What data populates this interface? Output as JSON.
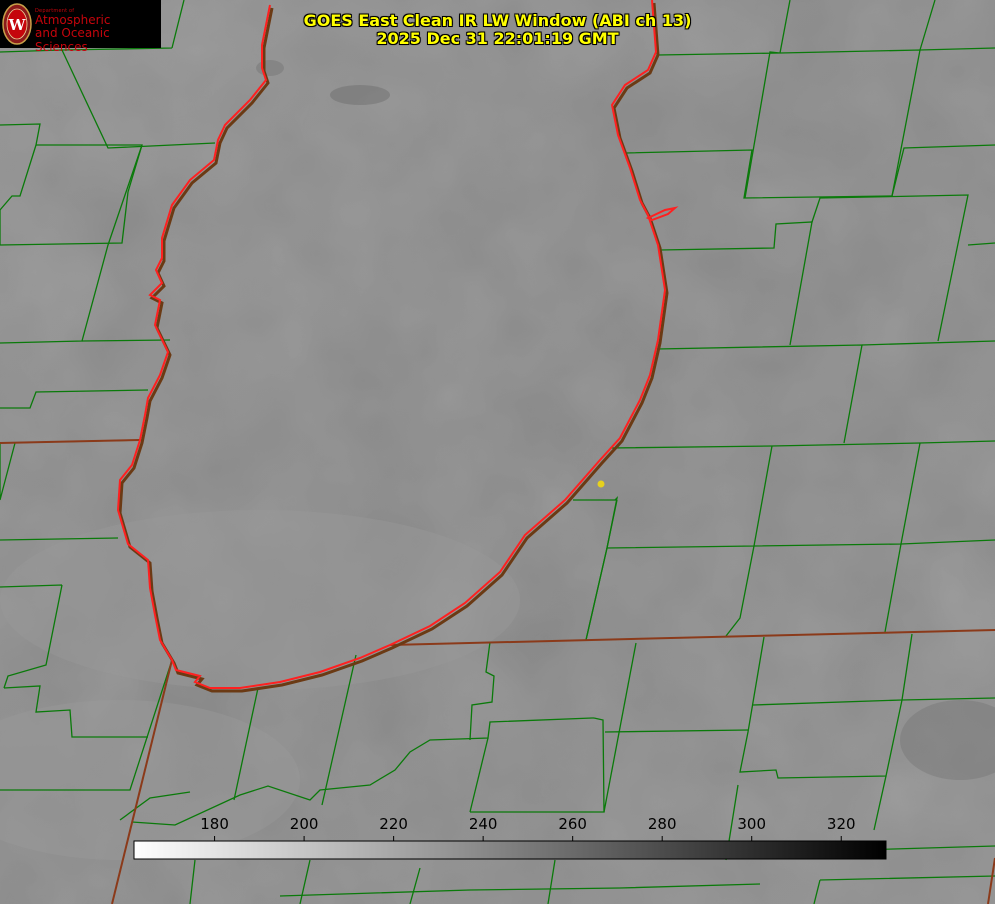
{
  "header": {
    "title_line1": "GOES East Clean IR LW Window (ABI ch 13)",
    "title_line2": "2025 Dec 31 22:01:19 GMT"
  },
  "logo": {
    "department": "Department of",
    "line1": "Atmospheric",
    "line2": "and Oceanic Sciences",
    "seal_letter": "W"
  },
  "colorbar": {
    "min": 162,
    "max": 330,
    "ticks": [
      180,
      200,
      220,
      240,
      260,
      280,
      300,
      320
    ],
    "tick_labels": [
      "180",
      "200",
      "220",
      "240",
      "260",
      "280",
      "300",
      "320"
    ],
    "gradient_start": "#ffffff",
    "gradient_end": "#000000"
  },
  "colors": {
    "title": "#ffff00",
    "county_lines": "#008000",
    "lake_outline": "#ff2020",
    "state_lines": "#8b3a1a",
    "marker": "#e6d11e",
    "logo_text": "#c5050c"
  }
}
